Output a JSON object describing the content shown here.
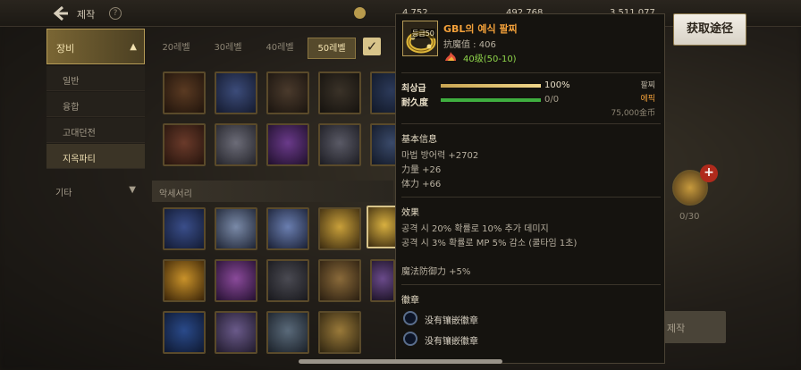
{
  "header": {
    "title": "제작",
    "help_glyph": "?",
    "currency_1": "4,752",
    "currency_2": "492,768",
    "currency_3": "3,511,077"
  },
  "sidebar": {
    "main_label": "장비",
    "items": [
      {
        "label": "일반"
      },
      {
        "label": "융합"
      },
      {
        "label": "고대던전"
      },
      {
        "label": "지옥파티"
      }
    ],
    "other_label": "기타"
  },
  "level_tabs": [
    {
      "label": "20레벨"
    },
    {
      "label": "30레벨"
    },
    {
      "label": "40레벨"
    },
    {
      "label": "50레벨"
    }
  ],
  "section_label": "악세서리",
  "right_panel": {
    "count": "0/30",
    "craft_label": "제작"
  },
  "acquire_button": "获取途径",
  "tooltip": {
    "level_badge": "등급50",
    "item_name": "GBL의 예식 팔찌",
    "sub_stat": "抗魔值 : 406",
    "item_level": "40级(50-10)",
    "stats": [
      {
        "label": "최상급",
        "value": "100%",
        "fill": 1.0
      },
      {
        "label": "耐久度",
        "value": "0/0",
        "fill": 1.0
      }
    ],
    "right_tags": {
      "type": "팔찌",
      "rarity": "에픽",
      "price": "75,000金币"
    },
    "basic_info_title": "基本信息",
    "basic_info": [
      "마법 방어력 +2702",
      "力量 +26",
      "体力 +66"
    ],
    "effect_title": "效果",
    "effects": [
      "공격 시 20% 확률로 10% 추가 데미지",
      "공격 시 3% 확률로 MP 5% 감소 (쿨타임 1초)"
    ],
    "magic_defense": "魔法防御力 +5%",
    "emblem_title": "徽章",
    "emblems": [
      {
        "label": "没有镶嵌徽章"
      },
      {
        "label": "没有镶嵌徽章"
      }
    ]
  },
  "colors": {
    "item_name": "#f2a03a",
    "item_level": "#8ed44a",
    "rarity": "#f2a03a",
    "durability_bar": "#3fae3f",
    "quality_bar": "#f0d68a"
  }
}
